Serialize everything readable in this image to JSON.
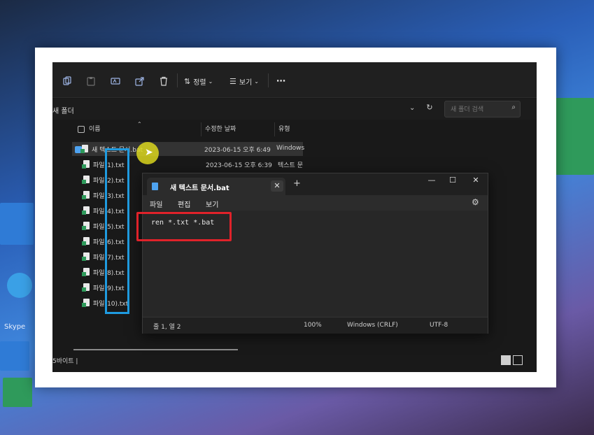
{
  "explorer": {
    "toolbar": {
      "sort_label": "정렬",
      "view_label": "보기",
      "more_label": "⋯"
    },
    "address": "새 폴더",
    "search_placeholder": "새 폴더 검색",
    "columns": {
      "name": "이름",
      "modified": "수정한 날짜",
      "type": "유형"
    },
    "files": [
      {
        "name": "새 텍스트 문서.bat",
        "date": "2023-06-15 오후 6:49",
        "type": "Windows"
      },
      {
        "name": "파일(1).txt",
        "date": "2023-06-15 오후 6:39",
        "type": "텍스트 문"
      },
      {
        "name": "파일(2).txt"
      },
      {
        "name": "파일(3).txt"
      },
      {
        "name": "파일(4).txt"
      },
      {
        "name": "파일(5).txt"
      },
      {
        "name": "파일(6).txt"
      },
      {
        "name": "파일(7).txt"
      },
      {
        "name": "파일(8).txt"
      },
      {
        "name": "파일(9).txt"
      },
      {
        "name": "파일(10).txt"
      }
    ],
    "status": "5바이트  |"
  },
  "notepad": {
    "tab_title": "새 텍스트 문서.bat",
    "close_tab": "✕",
    "new_tab": "+",
    "window_controls": {
      "minimize": "—",
      "maximize": "☐",
      "close": "✕"
    },
    "menu": {
      "file": "파일",
      "edit": "편집",
      "view": "보기"
    },
    "content": "ren *.txt *.bat",
    "status": {
      "position": "줄 1, 열 2",
      "zoom": "100%",
      "line_ending": "Windows (CRLF)",
      "encoding": "UTF-8"
    }
  },
  "background": {
    "tile_caption": "Skype"
  },
  "colors": {
    "annotation_blue": "#1f9be0",
    "annotation_red": "#e0222a",
    "cursor_highlight": "#dcd71e"
  }
}
